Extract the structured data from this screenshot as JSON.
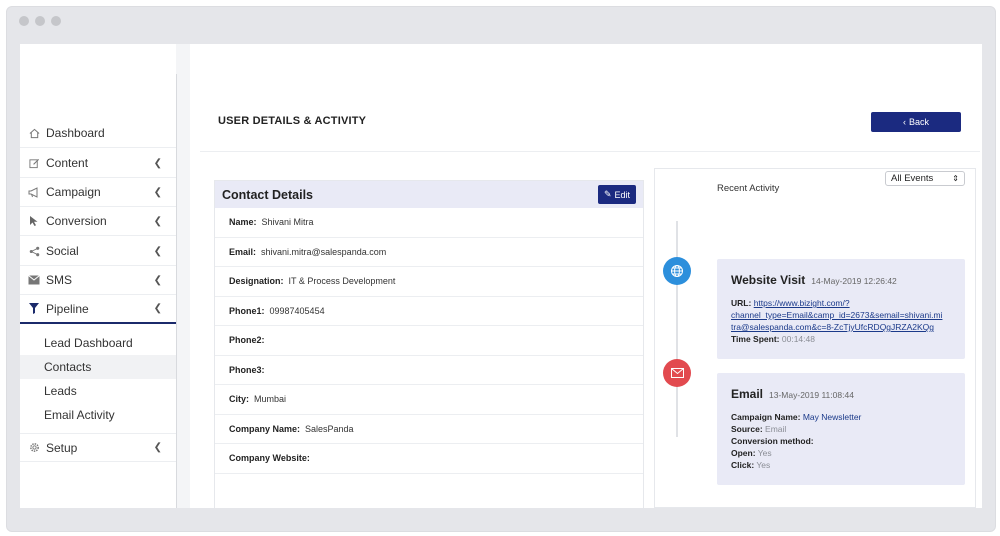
{
  "sidebar": {
    "items": [
      {
        "label": "Dashboard",
        "icon": "home-icon"
      },
      {
        "label": "Content",
        "icon": "edit-icon"
      },
      {
        "label": "Campaign",
        "icon": "megaphone-icon"
      },
      {
        "label": "Conversion",
        "icon": "pointer-icon"
      },
      {
        "label": "Social",
        "icon": "share-icon"
      },
      {
        "label": "SMS",
        "icon": "sms-icon"
      },
      {
        "label": "Pipeline",
        "icon": "filter-icon"
      }
    ],
    "pipeline_sub": [
      "Lead Dashboard",
      "Contacts",
      "Leads",
      "Email Activity"
    ],
    "setup": {
      "label": "Setup",
      "icon": "gear-icon"
    }
  },
  "header": {
    "title": "USER DETAILS & ACTIVITY",
    "back_label": "Back"
  },
  "contact": {
    "title": "Contact Details",
    "edit_label": "Edit",
    "fields": [
      {
        "key": "Name:",
        "value": "Shivani Mitra"
      },
      {
        "key": "Email:",
        "value": "shivani.mitra@salespanda.com"
      },
      {
        "key": "Designation:",
        "value": "IT & Process Development"
      },
      {
        "key": "Phone1:",
        "value": "09987405454"
      },
      {
        "key": "Phone2:",
        "value": ""
      },
      {
        "key": "Phone3:",
        "value": ""
      },
      {
        "key": "City:",
        "value": "Mumbai"
      },
      {
        "key": "Company Name:",
        "value": "SalesPanda"
      },
      {
        "key": "Company Website:",
        "value": ""
      }
    ]
  },
  "activity": {
    "label": "Recent Activity",
    "filter": "All Events",
    "website": {
      "title": "Website Visit",
      "time": "14-May-2019 12:26:42",
      "url_key": "URL:",
      "url_line1": "https://www.bizight.com/?",
      "url_line2": "channel_type=Email&camp_id=2673&semail=shivani.mi",
      "url_line3": "tra@salespanda.com&c=8-ZcTjyUfcRDQgJRZA2KQg",
      "spent_key": "Time Spent:",
      "spent_value": "00:14:48"
    },
    "email": {
      "title": "Email",
      "time": "13-May-2019 11:08:44",
      "campaign_key": "Campaign Name:",
      "campaign_value": "May Newsletter",
      "source_key": "Source:",
      "source_value": "Email",
      "conversion_key": "Conversion method:",
      "open_key": "Open:",
      "open_value": "Yes",
      "click_key": "Click:",
      "click_value": "Yes"
    }
  },
  "colors": {
    "primary": "#1b2a80",
    "web": "#2c8fdc",
    "email": "#e24a4f",
    "card": "#e9eaf6"
  }
}
